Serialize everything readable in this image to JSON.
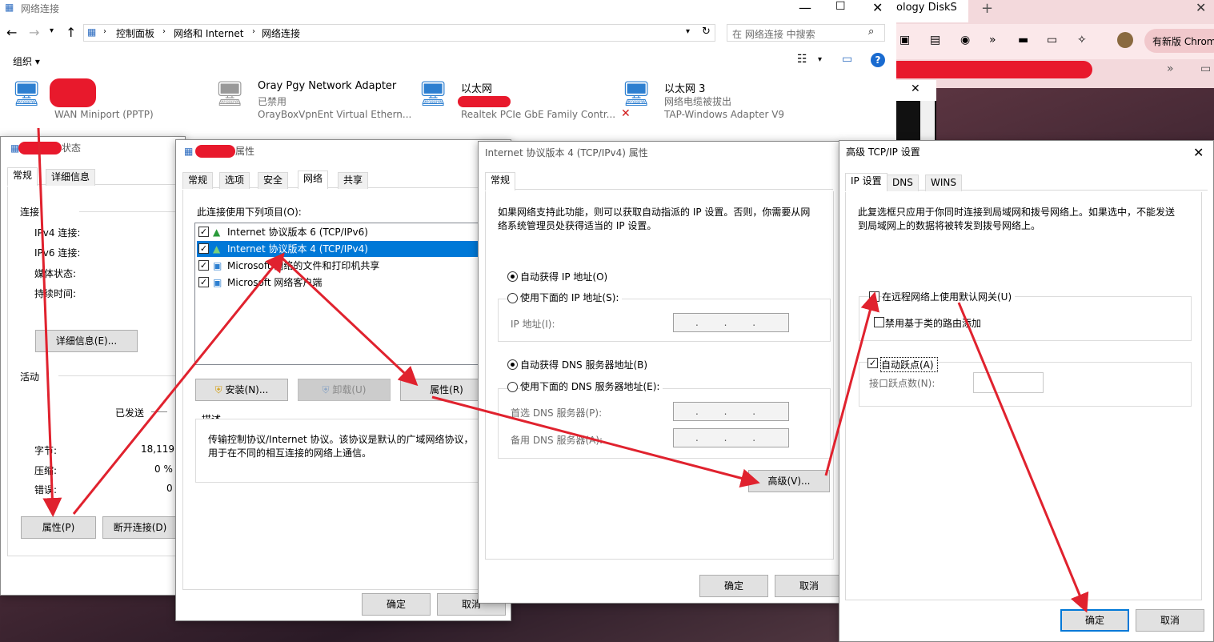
{
  "explorer": {
    "title": "网络连接",
    "breadcrumb": [
      "控制面板",
      "网络和 Internet",
      "网络连接"
    ],
    "search_placeholder": "在 网络连接 中搜索",
    "organize": "组织 ▾",
    "adapters": [
      {
        "name": "",
        "sub": "WAN Miniport (PPTP)"
      },
      {
        "name": "Oray Pgy Network Adapter",
        "status": "已禁用",
        "sub": "OrayBoxVpnEnt Virtual Ethern..."
      },
      {
        "name": "以太网",
        "status": "",
        "sub": "Realtek PCIe GbE Family Contr..."
      },
      {
        "name": "以太网 3",
        "status": "网络电缆被拔出",
        "sub": "TAP-Windows Adapter V9"
      }
    ]
  },
  "browser": {
    "tab_title": "ology DiskS",
    "update_label": "有新版 Chrom"
  },
  "status_dialog": {
    "title_suffix": "状态",
    "tabs": [
      "常规",
      "详细信息"
    ],
    "connection_group": "连接",
    "rows": [
      "IPv4 连接:",
      "IPv6 连接:",
      "媒体状态:",
      "持续时间:"
    ],
    "details_button": "详细信息(E)...",
    "activity_group": "活动",
    "sent_label": "已发送",
    "stats": [
      {
        "label": "字节:",
        "value": "18,119"
      },
      {
        "label": "压缩:",
        "value": "0 %"
      },
      {
        "label": "错误:",
        "value": "0"
      }
    ],
    "properties_button": "属性(P)",
    "disconnect_button": "断开连接(D)"
  },
  "props_dialog": {
    "title_suffix": "属性",
    "tabs": [
      "常规",
      "选项",
      "安全",
      "网络",
      "共享"
    ],
    "list_label": "此连接使用下列项目(O):",
    "items": [
      "Internet 协议版本 6 (TCP/IPv6)",
      "Internet 协议版本 4 (TCP/IPv4)",
      "Microsoft 网络的文件和打印机共享",
      "Microsoft 网络客户端"
    ],
    "install_button": "安装(N)...",
    "uninstall_button": "卸载(U)",
    "properties_button": "属性(R)",
    "desc_group": "描述",
    "description": "传输控制协议/Internet 协议。该协议是默认的广域网络协议，用于在不同的相互连接的网络上通信。",
    "ok_button": "确定",
    "cancel_button": "取消"
  },
  "ipv4_dialog": {
    "title": "Internet 协议版本 4 (TCP/IPv4) 属性",
    "tab": "常规",
    "intro": "如果网络支持此功能，则可以获取自动指派的 IP 设置。否则，你需要从网络系统管理员处获得适当的 IP 设置。",
    "auto_ip": "自动获得 IP 地址(O)",
    "manual_ip": "使用下面的 IP 地址(S):",
    "ip_label": "IP 地址(I):",
    "auto_dns": "自动获得 DNS 服务器地址(B)",
    "manual_dns": "使用下面的 DNS 服务器地址(E):",
    "dns1_label": "首选 DNS 服务器(P):",
    "dns2_label": "备用 DNS 服务器(A):",
    "ip_placeholder": ". . .",
    "advanced_button": "高级(V)...",
    "ok_button": "确定",
    "cancel_button": "取消"
  },
  "adv_dialog": {
    "title": "高级 TCP/IP 设置",
    "tabs": [
      "IP 设置",
      "DNS",
      "WINS"
    ],
    "info": "此复选框只应用于你同时连接到局域网和拨号网络上。如果选中，不能发送到局域网上的数据将被转发到拨号网络上。",
    "use_default_gateway": "在远程网络上使用默认网关(U)",
    "disable_class_route": "禁用基于类的路由添加",
    "auto_metric": "自动跃点(A)",
    "interface_metric": "接口跃点数(N):",
    "ok_button": "确定",
    "cancel_button": "取消"
  }
}
